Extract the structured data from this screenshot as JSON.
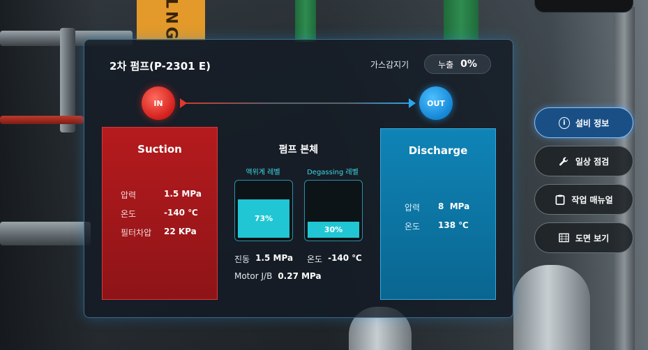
{
  "background_sign": "LNG",
  "panel": {
    "title": "2차 펌프(P-2301 E)",
    "gas_detector": {
      "label": "가스감지기",
      "status_label": "누출",
      "value": "0%"
    },
    "flow": {
      "in_label": "IN",
      "out_label": "OUT"
    },
    "suction": {
      "header": "Suction",
      "rows": [
        {
          "key": "압력",
          "value": "1.5 MPa"
        },
        {
          "key": "온도",
          "value": "-140 ℃"
        },
        {
          "key": "필터차압",
          "value": "22 KPa"
        }
      ]
    },
    "pump_body": {
      "header": "펌프 본체",
      "gauges": [
        {
          "label": "액위계 레벨",
          "value": "73%",
          "level": 0.73
        },
        {
          "label": "Degassing 레벨",
          "value": "30%",
          "level": 0.3
        }
      ],
      "stats": [
        {
          "key": "진동",
          "value": "1.5 MPa"
        },
        {
          "key": "온도",
          "value": "-140 ℃"
        },
        {
          "key": "Motor J/B",
          "value": "0.27 MPa"
        }
      ]
    },
    "discharge": {
      "header": "Discharge",
      "rows": [
        {
          "key": "압력",
          "value": "8  MPa"
        },
        {
          "key": "온도",
          "value": "138 ℃"
        }
      ]
    }
  },
  "side_menu": [
    {
      "label": "설비 정보",
      "icon": "info-icon",
      "active": true
    },
    {
      "label": "일상 점검",
      "icon": "wrench-icon",
      "active": false
    },
    {
      "label": "작업 매뉴얼",
      "icon": "clipboard-icon",
      "active": false
    },
    {
      "label": "도면 보기",
      "icon": "blueprint-icon",
      "active": false
    }
  ],
  "colors": {
    "suction": "#b51b1e",
    "discharge": "#0f84b6",
    "gauge_fill": "#21c6d4",
    "accent": "#1a4f86"
  }
}
